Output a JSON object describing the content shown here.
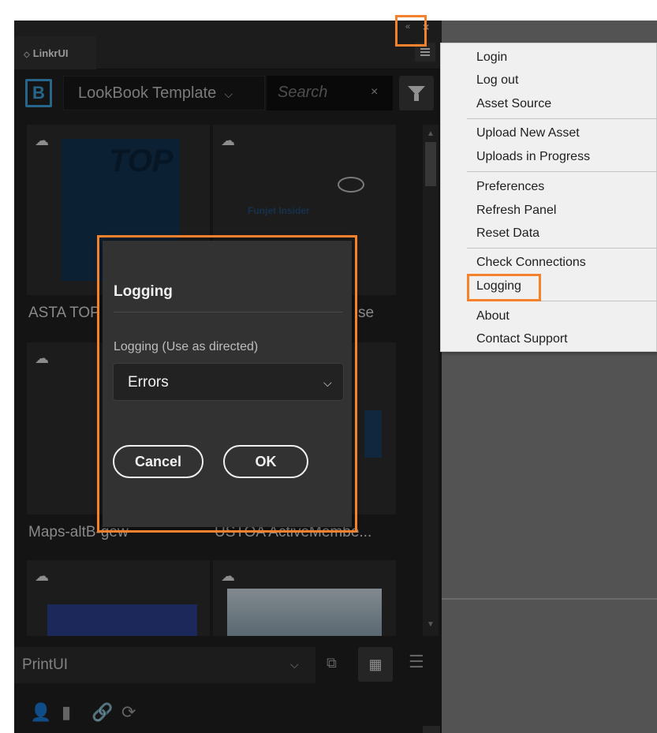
{
  "panel": {
    "tab_label": "LinkrUI",
    "template_select": "LookBook Template",
    "search_placeholder": "Search",
    "grid": [
      {
        "label": "ASTA TOP",
        "thumb_text": "TOP",
        "cloud": true
      },
      {
        "label": "se",
        "thumb_text": "Funjet Insider",
        "cloud": true
      },
      {
        "label": "Maps-altB-gew",
        "cloud": true
      },
      {
        "label": "USTOA ActiveMembe...",
        "cloud": true
      },
      {
        "label": "",
        "cloud": true
      },
      {
        "label": "",
        "cloud": true
      }
    ],
    "bottom_select": "PrintUI"
  },
  "dialog": {
    "title": "Logging",
    "field_label": "Logging (Use as directed)",
    "selected_value": "Errors",
    "cancel_label": "Cancel",
    "ok_label": "OK"
  },
  "menu": {
    "groups": [
      [
        "Login",
        "Log out",
        "Asset Source"
      ],
      [
        "Upload New Asset",
        "Uploads in Progress"
      ],
      [
        "Preferences",
        "Refresh Panel",
        "Reset Data"
      ],
      [
        "Check Connections",
        "Logging"
      ],
      [
        "About",
        "Contact Support"
      ]
    ],
    "highlighted": "Logging"
  },
  "colors": {
    "highlight": "#f4812b",
    "logo_blue": "#3d9bd6"
  }
}
